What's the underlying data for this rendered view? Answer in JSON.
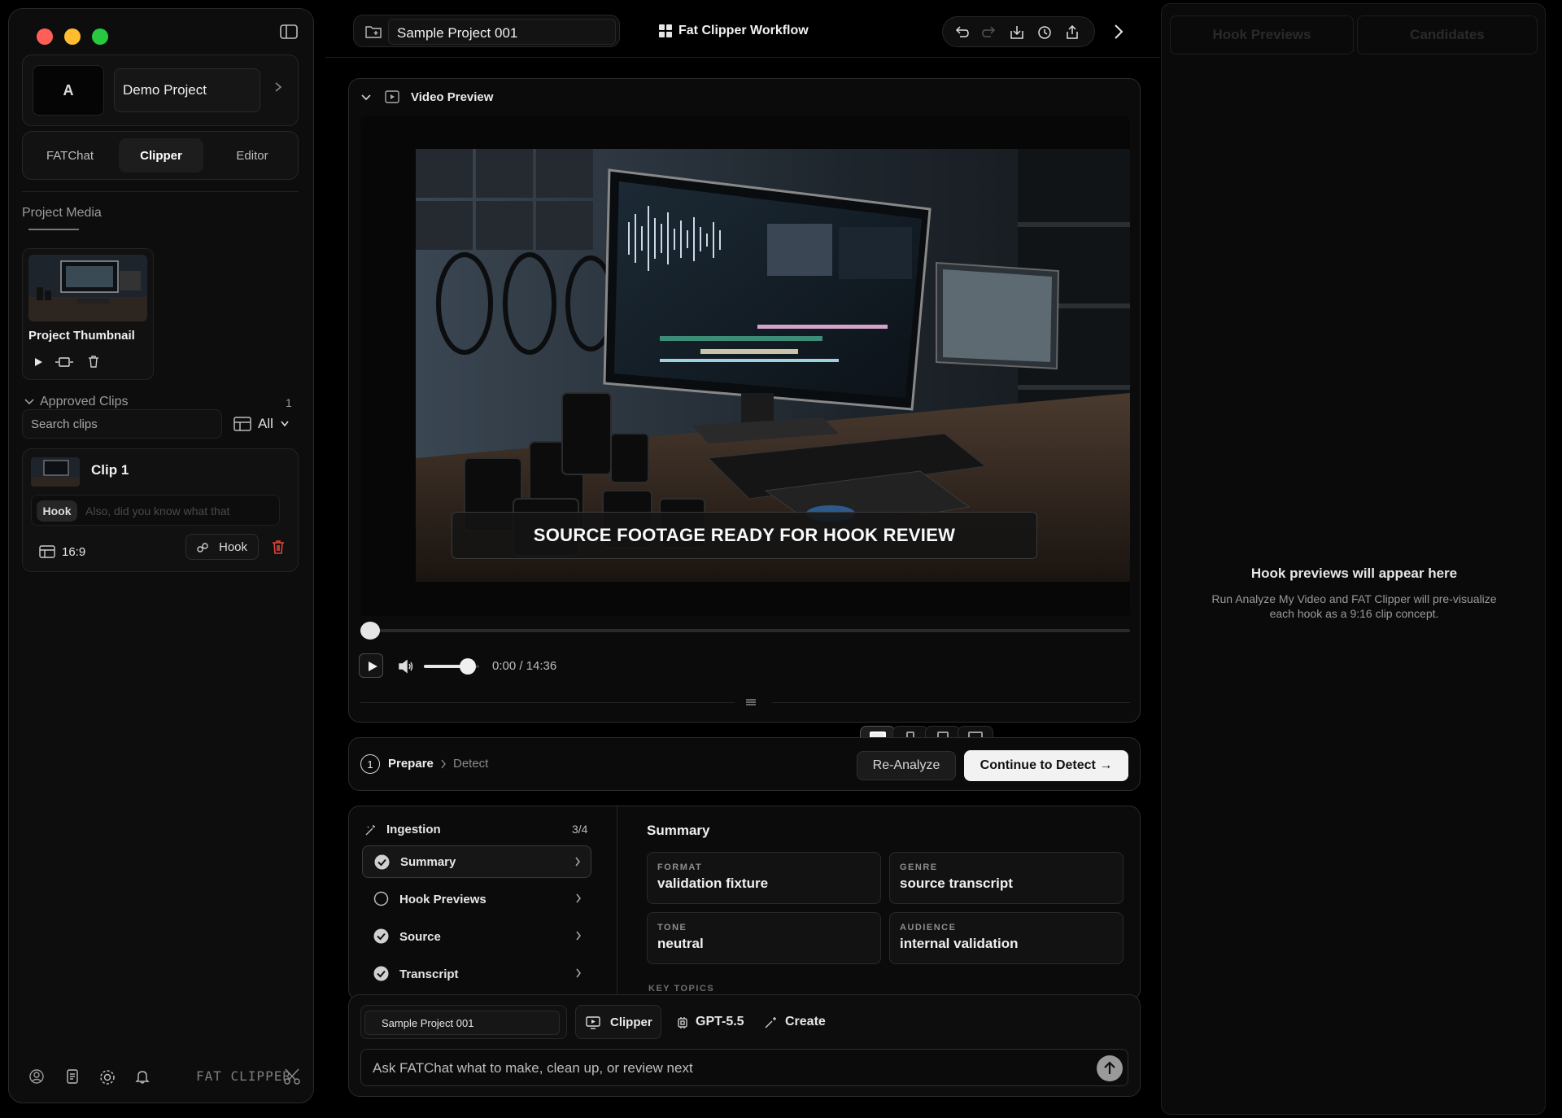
{
  "sidebar": {
    "avatar_letter": "A",
    "project_name": "Demo Project",
    "tabs": [
      {
        "label": "FATChat"
      },
      {
        "label": "Clipper"
      },
      {
        "label": "Editor"
      }
    ],
    "project_media_title": "Project Media",
    "thumbnail_label": "Project Thumbnail",
    "approved_clips": {
      "title": "Approved Clips",
      "count": "1"
    },
    "search_placeholder": "Search clips",
    "filter_label": "All",
    "clip": {
      "title": "Clip 1",
      "tag": "Hook",
      "text": "Also, did you know what that",
      "aspect": "16:9",
      "hook_button": "Hook"
    },
    "brand": "FAT CLIPPER"
  },
  "topbar": {
    "project_chip": "Sample Project 001",
    "workflow_title": "Fat Clipper Workflow"
  },
  "video": {
    "panel_title": "Video Preview",
    "caption": "SOURCE FOOTAGE READY FOR HOOK REVIEW",
    "time": "0:00 / 14:36",
    "progress": 0,
    "volume": 0.8,
    "aspect_ratios": [
      {
        "label": "16:9",
        "active": true
      },
      {
        "label": "9:16",
        "active": false
      },
      {
        "label": "4:5",
        "active": false
      },
      {
        "label": "1:1",
        "active": false
      }
    ]
  },
  "steps": {
    "number": "1",
    "current": "Prepare",
    "next": "Detect",
    "reanalyze": "Re-Analyze",
    "continue": "Continue to Detect →"
  },
  "ingestion": {
    "title": "Ingestion",
    "progress": "3/4",
    "items": [
      {
        "label": "Summary",
        "done": true
      },
      {
        "label": "Hook Previews",
        "done": false
      },
      {
        "label": "Source",
        "done": true
      },
      {
        "label": "Transcript",
        "done": true
      }
    ]
  },
  "summary": {
    "title": "Summary",
    "fields": [
      {
        "key": "FORMAT",
        "value": "validation fixture"
      },
      {
        "key": "GENRE",
        "value": "source transcript"
      },
      {
        "key": "TONE",
        "value": "neutral"
      },
      {
        "key": "AUDIENCE",
        "value": "internal validation"
      }
    ],
    "key_topics": "KEY TOPICS"
  },
  "chat": {
    "project_chip": "Sample Project 001",
    "mode": "Clipper",
    "model": "GPT-5.5",
    "create": "Create",
    "placeholder": "Ask FATChat what to make, clean up, or review next"
  },
  "right": {
    "tabs": [
      {
        "label": "Hook Previews"
      },
      {
        "label": "Candidates"
      }
    ],
    "empty_title": "Hook previews will appear here",
    "empty_text": "Run Analyze My Video and FAT Clipper will pre-visualize each hook as a 9:16 clip concept."
  }
}
